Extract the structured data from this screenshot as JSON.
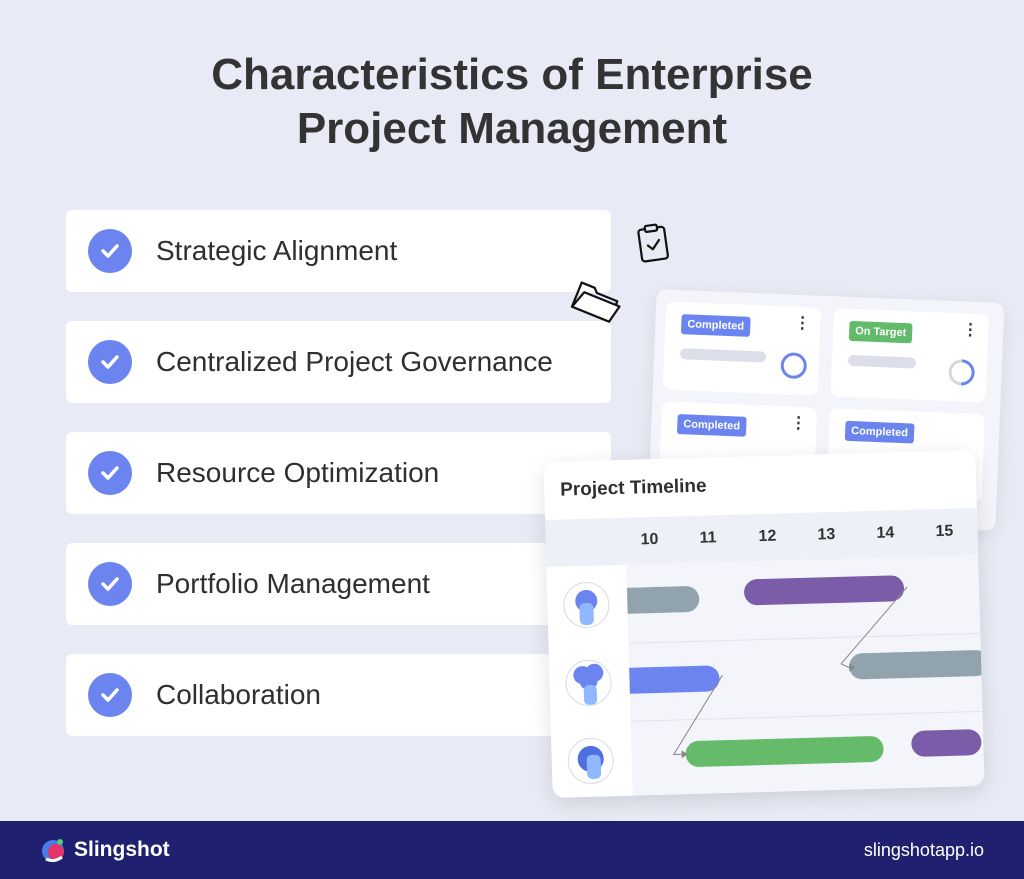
{
  "title": {
    "line1": "Characteristics of Enterprise",
    "line2": "Project Management"
  },
  "items": [
    {
      "label": "Strategic Alignment",
      "icon": "check-circle-icon"
    },
    {
      "label": "Centralized Project Governance",
      "icon": "check-circle-icon"
    },
    {
      "label": "Resource Optimization",
      "icon": "check-circle-icon"
    },
    {
      "label": "Portfolio Management",
      "icon": "check-circle-icon"
    },
    {
      "label": "Collaboration",
      "icon": "check-circle-icon"
    }
  ],
  "dashboard": {
    "tiles": [
      {
        "status": "Completed",
        "color": "#6b84f0",
        "progress": 100
      },
      {
        "status": "On Target",
        "color": "#62bb6a",
        "progress": 40
      },
      {
        "status": "Completed",
        "color": "#6b84f0"
      },
      {
        "status": "Completed",
        "color": "#6b84f0"
      }
    ]
  },
  "timeline": {
    "title": "Project Timeline",
    "dates": [
      "10",
      "11",
      "12",
      "13",
      "14",
      "15"
    ],
    "colors": {
      "gray": "#91a4ad",
      "purple": "#7a5ca8",
      "blue": "#6b84f0",
      "green": "#65bb6a"
    }
  },
  "footer": {
    "brand": "Slingshot",
    "url": "slingshotapp.io",
    "bg": "#1f2170"
  }
}
